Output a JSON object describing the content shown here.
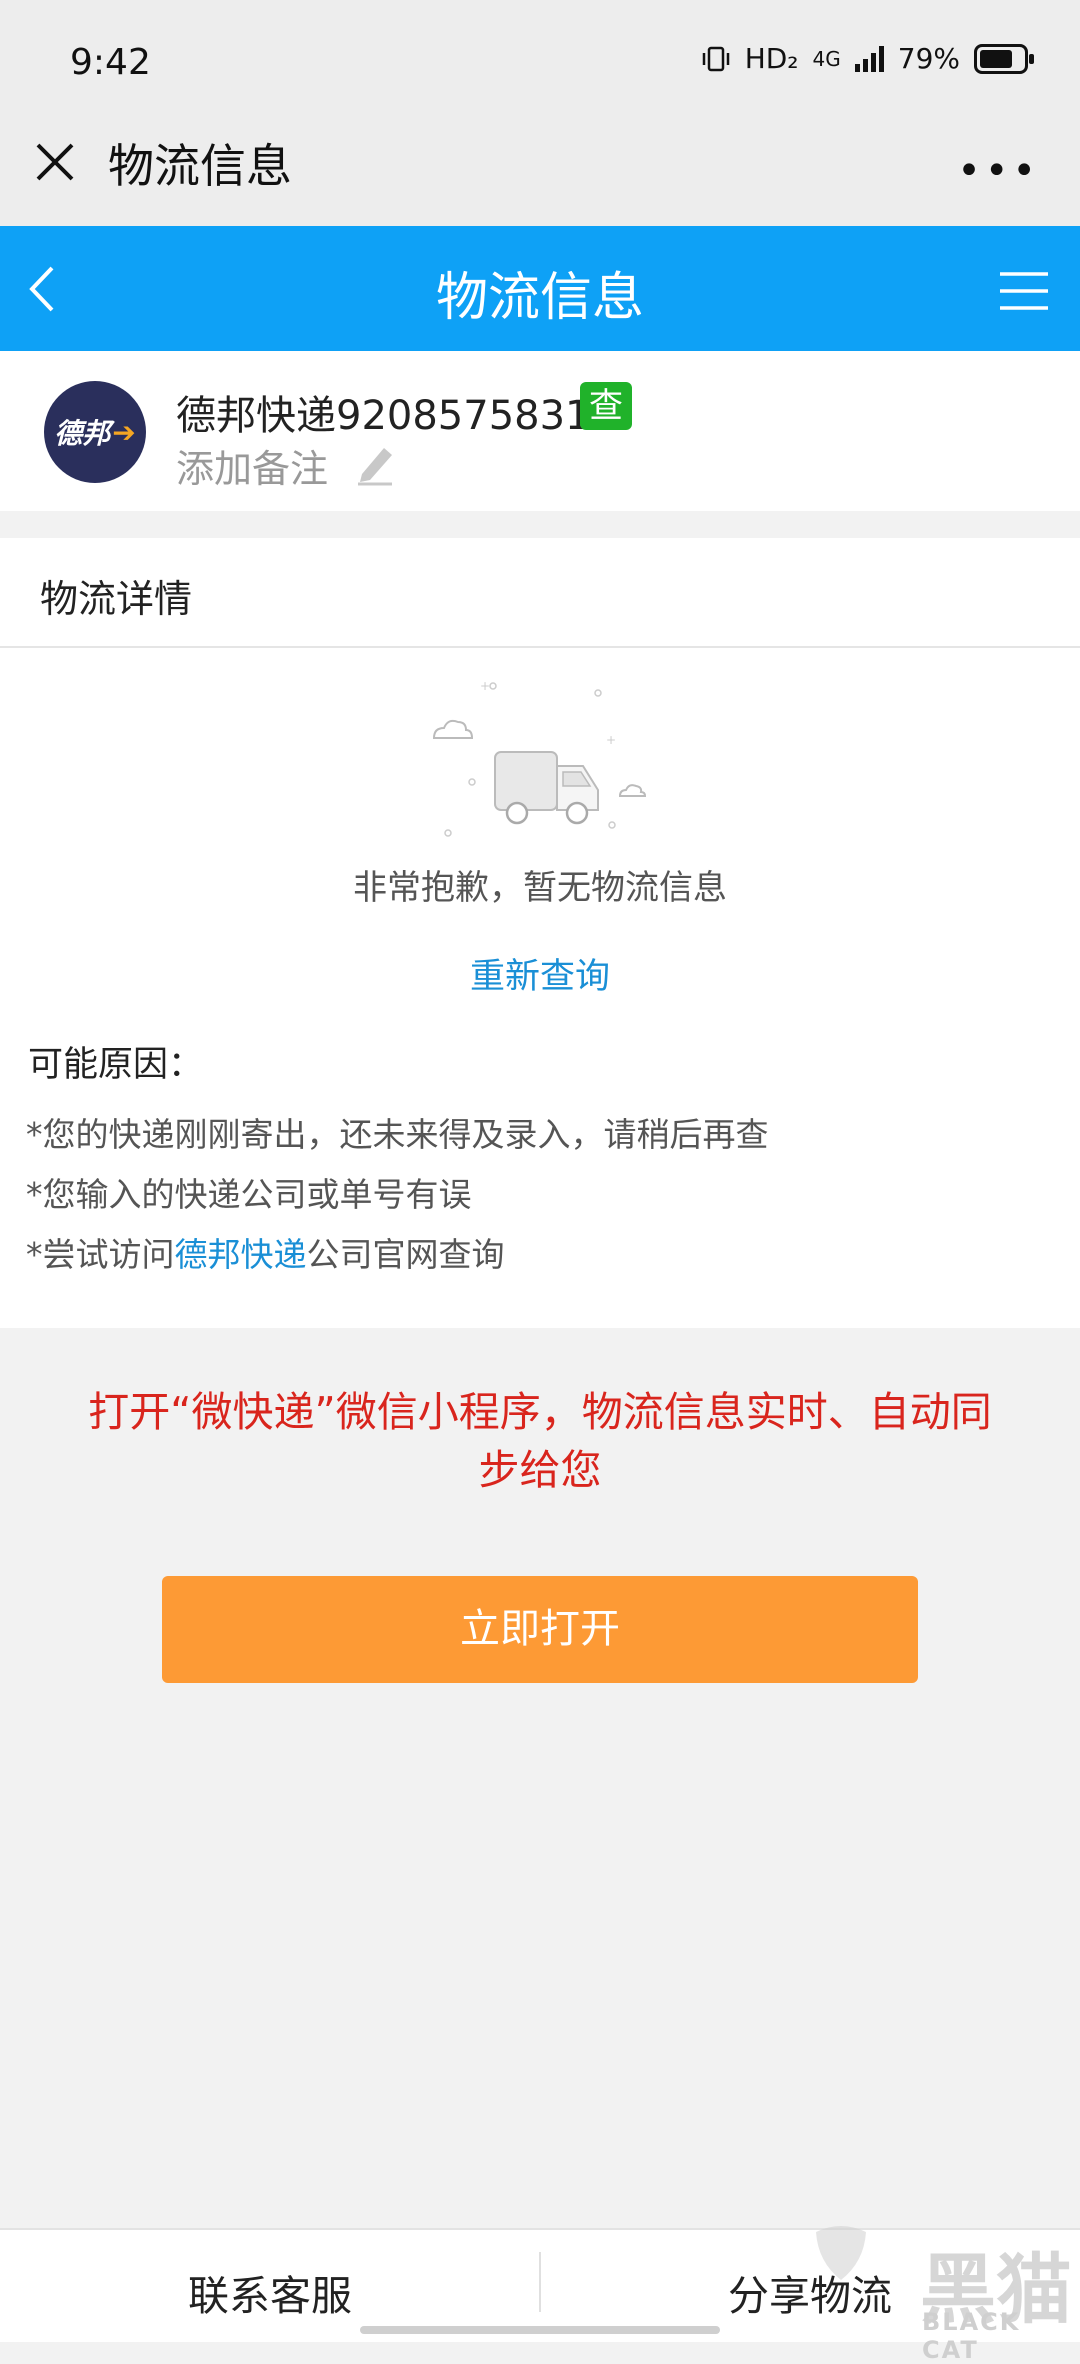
{
  "status_bar": {
    "time": "9:42",
    "hd": "HD₂",
    "network": "4G",
    "battery": "79%"
  },
  "wechat_header": {
    "title": "物流信息",
    "more": "•••"
  },
  "blue_header": {
    "title": "物流信息"
  },
  "package": {
    "logo_text": "德邦",
    "name": "德邦快递9208575831",
    "badge": "查",
    "note_placeholder": "添加备注"
  },
  "details": {
    "heading": "物流详情",
    "empty_message": "非常抱歉，暂无物流信息",
    "retry_label": "重新查询",
    "reasons_heading": "可能原因：",
    "reason_1": "*您的快递刚刚寄出，还未来得及录入，请稍后再查",
    "reason_2": "*您输入的快递公司或单号有误",
    "reason_3_prefix": "*尝试访问",
    "reason_3_link": "德邦快递",
    "reason_3_suffix": "公司官网查询"
  },
  "promo": {
    "text": "打开“微快递”微信小程序，物流信息实时、自动同步给您",
    "button": "立即打开"
  },
  "bottom_bar": {
    "contact": "联系客服",
    "share": "分享物流"
  },
  "watermark": {
    "text": "黑猫",
    "sub": "BLACK CAT"
  },
  "colors": {
    "blue_header": "#0ea1f6",
    "link": "#1a8fd6",
    "promo_red": "#d9251d",
    "button_orange": "#fd9a35",
    "badge_green": "#20b22a"
  }
}
